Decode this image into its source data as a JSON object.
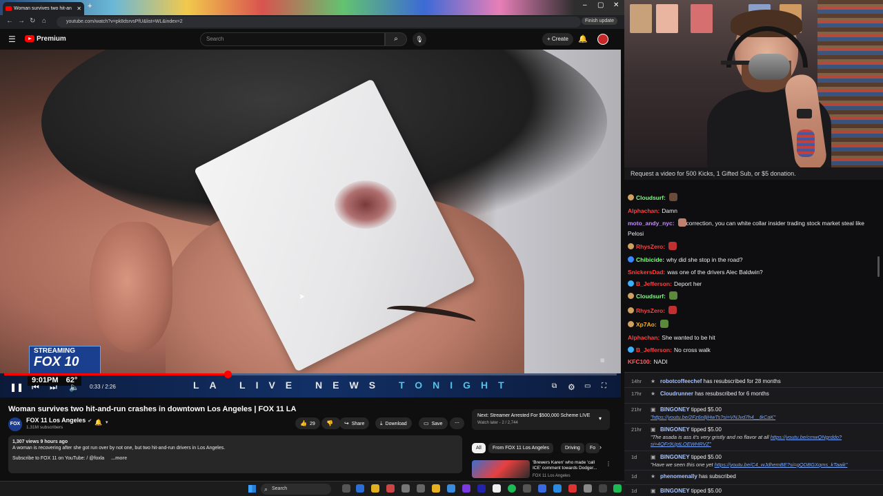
{
  "browser": {
    "tab_title": "Woman survives two hit-an",
    "url": "youtube.com/watch?v=pk8dsrvsPfU&list=WL&index=2",
    "finish_update": "Finish update"
  },
  "yt": {
    "brand": "Premium",
    "search_placeholder": "Search",
    "create_label": "Create"
  },
  "video": {
    "overlay_streaming": "STREAMING",
    "overlay_station": "FOX 10",
    "overlay_time": "9:01PM",
    "overlay_temp": "62°",
    "ticker_main": "LA LIVE NEWS",
    "ticker_accent": "TONIGHT",
    "time_readout": "0:33 / 2:26",
    "progress": 0.365,
    "title": "Woman survives two hit-and-run crashes in downtown Los Angeles | FOX 11 LA"
  },
  "channel": {
    "name": "FOX 11 Los Angeles",
    "subs": "1.31M subscribers",
    "avatar_text": "FOX 11"
  },
  "actions": {
    "likes": "29",
    "share": "Share",
    "download": "Download",
    "save": "Save"
  },
  "description": {
    "meta": "1,307 views  9 hours ago",
    "line1": "A woman is recovering after she got run over by not one, but two hit-and-run drivers in Los Angeles.",
    "line2": "Subscribe to FOX 11 on YouTube: ",
    "line2_handle": "/ @foxla",
    "more": "...more"
  },
  "next_up": {
    "title": "Next: Streamer Arrested For $500,000 Scheme LIVE",
    "sub": "Watch later - 2 / 2,744"
  },
  "chips": [
    "All",
    "From FOX 11 Los Angeles",
    "Driving",
    "Fo"
  ],
  "recommendation": {
    "title": "'Brewers Karen' who made 'call ICE' comment towards Dodger...",
    "channel": "FOX 11 Los Angeles"
  },
  "taskbar": {
    "search": "Search"
  },
  "stream": {
    "request_banner": "Request a video for 500 Kicks, 1 Gifted Sub, or $5 donation."
  },
  "chat": [
    {
      "user": "Cloudsurf:",
      "color": "#7fff7f",
      "text": "",
      "badge": "#d0a060",
      "emote": "#6a4a3a"
    },
    {
      "user": "Alphachan:",
      "color": "#ff4040",
      "text": "Damn",
      "badge": "",
      "emote": ""
    },
    {
      "user": "moto_andy_nyc:",
      "color": "#c58aff",
      "text": "correction, you can white collar insider trading stock market steal like",
      "badge": "",
      "emote": "#c08070"
    },
    {
      "user": "",
      "color": "#efeff1",
      "text": "Pelosi",
      "badge": "",
      "emote": ""
    },
    {
      "user": "RhysZero:",
      "color": "#ff4040",
      "text": "",
      "badge": "#d0a060",
      "emote": "#c03030"
    },
    {
      "user": "Chibicide:",
      "color": "#7fff7f",
      "text": "why did she stop in the road?",
      "badge": "#3a8aff",
      "emote": ""
    },
    {
      "user": "SnickersDad:",
      "color": "#ff4040",
      "text": "was one of the drivers Alec Baldwin?",
      "badge": "",
      "emote": ""
    },
    {
      "user": "B_Jefferson:",
      "color": "#ff4040",
      "text": "Deport her",
      "badge": "#3ab0ff",
      "emote": ""
    },
    {
      "user": "Cloudsurf:",
      "color": "#7fff7f",
      "text": "",
      "badge": "#d0a060",
      "emote": "#5a8a3a"
    },
    {
      "user": "RhysZero:",
      "color": "#ff4040",
      "text": "",
      "badge": "#d0a060",
      "emote": "#c03030"
    },
    {
      "user": "Xp7Ao:",
      "color": "#ffb020",
      "text": "",
      "badge": "#d0a060",
      "emote": "#5a8a3a"
    },
    {
      "user": "Alphachan:",
      "color": "#ff4040",
      "text": "She wanted to be hit",
      "badge": "",
      "emote": ""
    },
    {
      "user": "B_Jefferson:",
      "color": "#ff4040",
      "text": "No cross walk",
      "badge": "#3ab0ff",
      "emote": ""
    },
    {
      "user": "KFC100:",
      "color": "#ff6060",
      "text": "NADI",
      "badge": "",
      "emote": ""
    }
  ],
  "feed": [
    {
      "time": "14hr",
      "user": "robotcoffeechef",
      "text": " has resubscribed for 28 months",
      "msg": "",
      "msg_link": "",
      "cont": ""
    },
    {
      "time": "17hr",
      "user": "Cloudrunner",
      "text": " has resubscribed for 6 months",
      "msg": "",
      "msg_link": "",
      "cont": ""
    },
    {
      "time": "21hr",
      "user": "BINGONEY",
      "text": " tipped $5.00",
      "msg": "",
      "msg_link": "\"https://youtu.be/2Fz6n8jHwTs?si=VNJvd7h4__tkCaK\"",
      "cont": ""
    },
    {
      "time": "21hr",
      "user": "BINGONEY",
      "text": " tipped $5.00",
      "msg": "\"The asada is ass it's very gristly and no flavor at all ",
      "msg_link": "https://youtu.be/cmwQNgrddo?",
      "cont": "si=4QFr9UptLOEWHRVZ\""
    },
    {
      "time": "1d",
      "user": "BINGONEY",
      "text": " tipped $5.00",
      "msg": "\"Have we seen this one yet ",
      "msg_link": "https://youtu.be/C4_wJdhemBE?si=gQDBGXqms_kTaaik\"",
      "cont": ""
    },
    {
      "time": "1d",
      "user": "phenomenally",
      "text": " has subscribed",
      "msg": "",
      "msg_link": "",
      "cont": ""
    },
    {
      "time": "1d",
      "user": "BINGONEY",
      "text": " tipped $5.00",
      "msg": "",
      "msg_link": "",
      "cont": ""
    }
  ]
}
